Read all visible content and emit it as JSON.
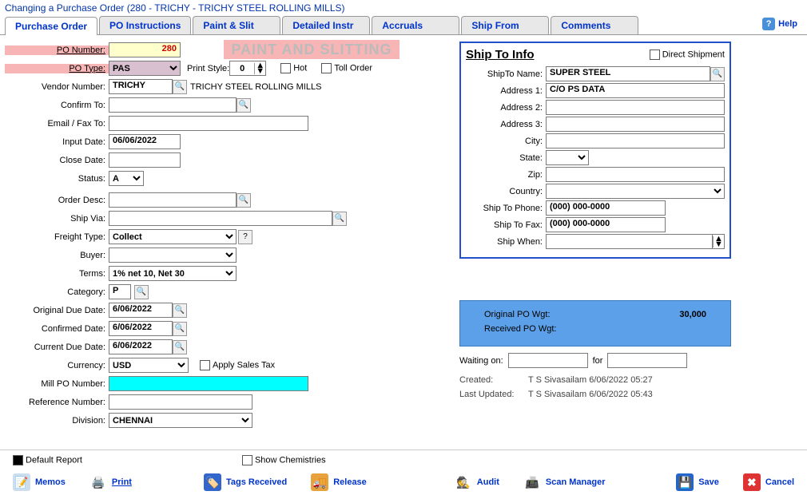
{
  "window_title": "Changing a Purchase Order  (280 - TRICHY - TRICHY STEEL ROLLING MILLS)",
  "help_label": "Help",
  "tabs": {
    "t0": "Purchase Order",
    "t1": "PO Instructions",
    "t2": "Paint & Slit",
    "t3": "Detailed Instr",
    "t4": "Accruals",
    "t5": "Ship From",
    "t6": "Comments"
  },
  "banner": "PAINT AND SLITTING",
  "labels": {
    "po_number": "PO Number:",
    "po_type": "PO Type:",
    "print_style": "Print Style:",
    "hot": "Hot",
    "toll_order": "Toll Order",
    "vendor_number": "Vendor Number:",
    "confirm_to": "Confirm To:",
    "email_fax": "Email / Fax To:",
    "input_date": "Input Date:",
    "close_date": "Close Date:",
    "status": "Status:",
    "order_desc": "Order Desc:",
    "ship_via": "Ship Via:",
    "freight_type": "Freight Type:",
    "buyer": "Buyer:",
    "terms": "Terms:",
    "category": "Category:",
    "original_due": "Original Due Date:",
    "confirmed_date": "Confirmed Date:",
    "current_due": "Current Due Date:",
    "currency": "Currency:",
    "apply_tax": "Apply Sales Tax",
    "mill_po": "Mill PO Number:",
    "reference": "Reference Number:",
    "division": "Division:"
  },
  "values": {
    "po_number": "280",
    "po_type": "PAS",
    "print_style": "0",
    "vendor_number": "TRICHY",
    "vendor_name": "TRICHY STEEL ROLLING MILLS",
    "confirm_to": "",
    "email_fax": "",
    "input_date": "06/06/2022",
    "close_date": "",
    "status": "A",
    "order_desc": "",
    "ship_via": "",
    "freight_type": "Collect",
    "freight_help": "?",
    "buyer": "",
    "terms": "1% net 10, Net 30",
    "category": "P",
    "original_due": "6/06/2022",
    "confirmed_date": "6/06/2022",
    "current_due": "6/06/2022",
    "currency": "USD",
    "mill_po": "",
    "reference": "",
    "division": "CHENNAI"
  },
  "shipto": {
    "title": "Ship To Info",
    "direct": "Direct Shipment",
    "name_l": "ShipTo Name:",
    "addr1_l": "Address 1:",
    "addr2_l": "Address 2:",
    "addr3_l": "Address 3:",
    "city_l": "City:",
    "state_l": "State:",
    "zip_l": "Zip:",
    "country_l": "Country:",
    "phone_l": "Ship To Phone:",
    "fax_l": "Ship To Fax:",
    "when_l": "Ship When:",
    "name": "SUPER STEEL",
    "addr1": "C/O PS DATA",
    "addr2": "",
    "addr3": "",
    "city": "",
    "state": "",
    "zip": "",
    "country": "",
    "phone": "(000) 000-0000",
    "fax": "(000) 000-0000",
    "when": ""
  },
  "summary": {
    "original_wgt_l": "Original PO Wgt:",
    "original_wgt": "30,000",
    "received_wgt_l": "Received PO Wgt:",
    "received_wgt": ""
  },
  "waiting": {
    "label": "Waiting on:",
    "for": "for",
    "v1": "",
    "v2": ""
  },
  "meta": {
    "created_l": "Created:",
    "created_v": "T S Sivasailam 6/06/2022 05:27",
    "updated_l": "Last Updated:",
    "updated_v": "T S Sivasailam 6/06/2022 05:43"
  },
  "bottom": {
    "default_report": "Default Report",
    "show_chem": "Show Chemistries",
    "memos": "Memos",
    "print": "Print",
    "tags": "Tags Received",
    "release": "Release",
    "audit": "Audit",
    "scan": "Scan Manager",
    "save": "Save",
    "cancel": "Cancel"
  }
}
